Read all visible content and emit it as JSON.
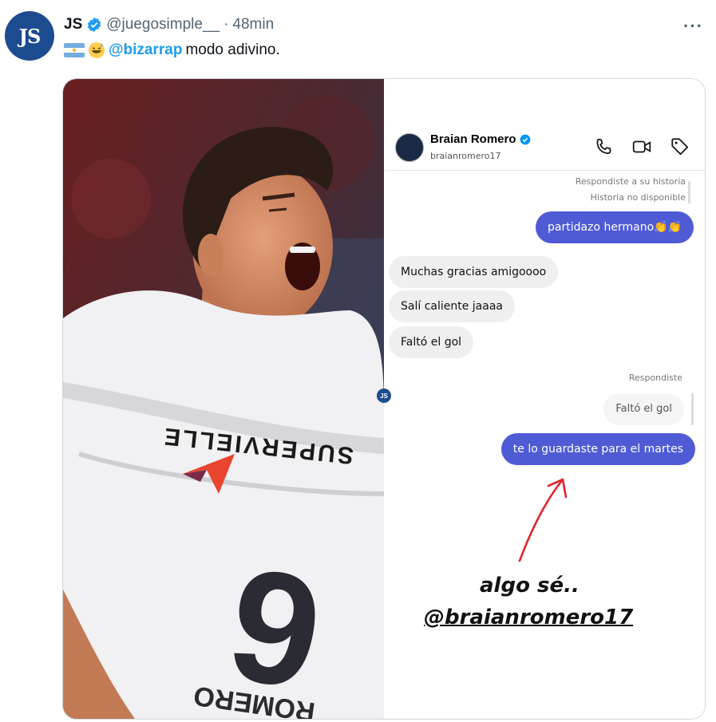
{
  "tweet": {
    "avatar_text": "JS",
    "display_name": "JS",
    "handle": "@juegosimple__",
    "separator": "·",
    "time": "48min",
    "more": "···",
    "mention": "@bizarrap",
    "text": "modo adivino.",
    "flag_icon": "argentina-flag-icon",
    "emoji_icon": "grinning-sweat-emoji-icon"
  },
  "media": {
    "divider_badge": "JS",
    "photo": {
      "jersey_sponsor": "SUPERVIELLE",
      "jersey_number": "6",
      "jersey_name": "ROMERO"
    },
    "dm": {
      "contact_name": "Braian Romero",
      "contact_username": "braianromero17",
      "header_icons": [
        "phone-icon",
        "video-icon",
        "tag-icon"
      ],
      "meta_replied_story": "Respondiste a su historia",
      "meta_story_unavailable": "Historia no disponible",
      "messages": [
        {
          "dir": "out",
          "text": "partidazo hermano👏👏"
        },
        {
          "dir": "in",
          "text": "Muchas gracias amigoooo"
        },
        {
          "dir": "in",
          "text": "Salí caliente jaaaa"
        },
        {
          "dir": "in",
          "text": "Faltó el gol"
        }
      ],
      "meta_replied": "Respondiste",
      "quoted_text": "Faltó el gol",
      "reply_text": "te lo guardaste para el martes",
      "story_caption": "algo sé..",
      "story_mention": "@braianromero17"
    },
    "colors": {
      "outgoing_bubble": "#4f5bd5",
      "incoming_bubble": "#efefef",
      "link_blue": "#1d9bf0",
      "arrow_red": "#e0242b"
    }
  }
}
